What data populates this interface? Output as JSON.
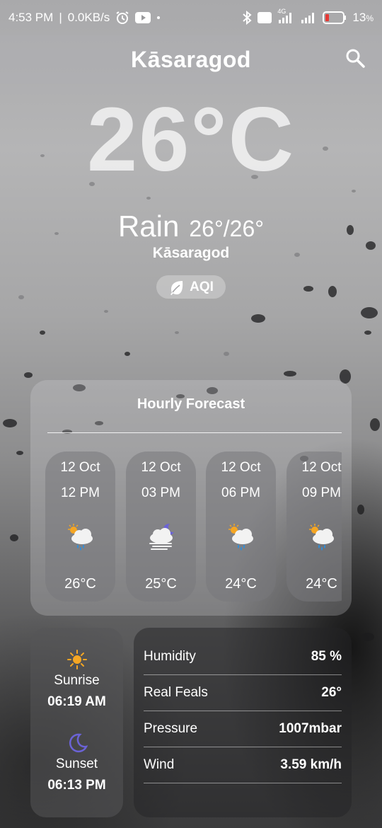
{
  "status_bar": {
    "time": "4:53 PM",
    "network_speed": "0.0KB/s",
    "battery": "13",
    "battery_unit": "%",
    "signal_tag": "4G",
    "icons": [
      "alarm-icon",
      "youtube-icon",
      "bluetooth-icon",
      "volte-icon",
      "signal-icon",
      "battery-icon"
    ]
  },
  "header": {
    "title": "Kāsaragod",
    "search_icon": "search-icon"
  },
  "current": {
    "temperature": "26°C",
    "condition": "Rain",
    "range": "26°/26°",
    "city": "Kāsaragod",
    "aqi_label": "AQI",
    "aqi_icon": "leaf-icon"
  },
  "hourly": {
    "title": "Hourly Forecast",
    "items": [
      {
        "date": "12 Oct",
        "time": "12 PM",
        "temp": "26°C",
        "icon": "sun-cloud-rain-icon"
      },
      {
        "date": "12 Oct",
        "time": "03 PM",
        "temp": "25°C",
        "icon": "moon-cloud-fog-icon"
      },
      {
        "date": "12 Oct",
        "time": "06 PM",
        "temp": "24°C",
        "icon": "sun-cloud-rain-icon"
      },
      {
        "date": "12 Oct",
        "time": "09 PM",
        "temp": "24°C",
        "icon": "sun-cloud-rain-icon"
      }
    ]
  },
  "sun": {
    "sunrise_label": "Sunrise",
    "sunrise_time": "06:19 AM",
    "sunset_label": "Sunset",
    "sunset_time": "06:13 PM"
  },
  "details": [
    {
      "label": "Humidity",
      "value": "85 %"
    },
    {
      "label": "Real Feals",
      "value": "26°"
    },
    {
      "label": "Pressure",
      "value": "1007mbar"
    },
    {
      "label": "Wind",
      "value": "3.59 km/h"
    }
  ],
  "colors": {
    "sun": "#f5a623",
    "moon": "#6b63d6",
    "rain": "#2a8fe0",
    "cloud": "#f2f2f2"
  }
}
